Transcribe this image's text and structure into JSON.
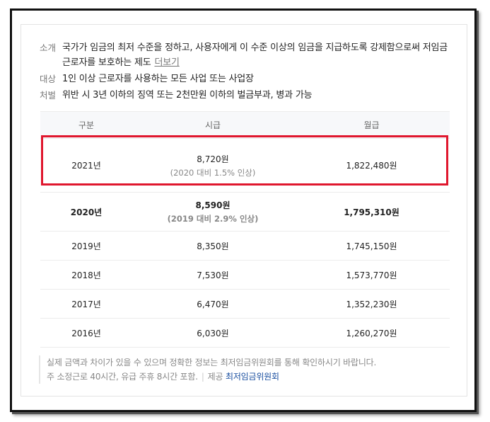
{
  "info": {
    "rows": [
      {
        "key": "소개",
        "value": "국가가 임금의 최저 수준을 정하고, 사용자에게 이 수준 이상의 임금을 지급하도록 강제함으로써 저임금 근로자를 보호하는 제도",
        "link": "더보기"
      },
      {
        "key": "대상",
        "value": "1인 이상 근로자를 사용하는 모든 사업 또는 사업장"
      },
      {
        "key": "처벌",
        "value": "위반 시 3년 이하의 징역 또는 2천만원 이하의 벌금부과, 병과 가능"
      }
    ]
  },
  "table": {
    "headers": [
      "구분",
      "시급",
      "월급"
    ],
    "rows": [
      {
        "year": "2021년",
        "hourly": "8,720원",
        "hourly_note": "(2020 대비 1.5% 인상)",
        "monthly": "1,822,480원"
      },
      {
        "year": "2020년",
        "hourly": "8,590원",
        "hourly_note": "(2019 대비 2.9% 인상)",
        "monthly": "1,795,310원"
      },
      {
        "year": "2019년",
        "hourly": "8,350원",
        "monthly": "1,745,150원"
      },
      {
        "year": "2018년",
        "hourly": "7,530원",
        "monthly": "1,573,770원"
      },
      {
        "year": "2017년",
        "hourly": "6,470원",
        "monthly": "1,352,230원"
      },
      {
        "year": "2016년",
        "hourly": "6,030원",
        "monthly": "1,260,270원"
      }
    ]
  },
  "note": {
    "line1": "실제 금액과 차이가 있을 수 있으며 정확한 정보는 최저임금위원회를 통해 확인하시기 바랍니다.",
    "line2": "주 소정근로 40시간, 유급 주휴 8시간 포함.",
    "provider_label": "제공",
    "provider_name": "최저임금위원회"
  },
  "colors": {
    "highlight": "#e0172e",
    "link": "#1a4fa0"
  }
}
